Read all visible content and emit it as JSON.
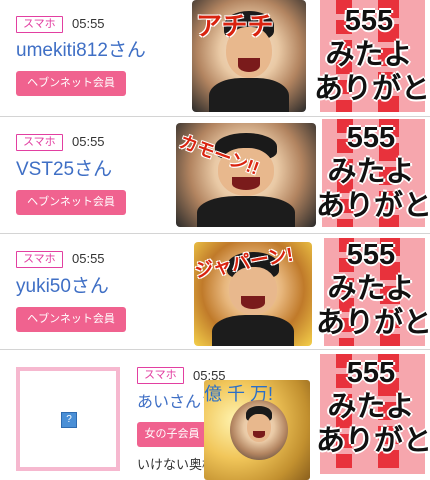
{
  "posts": [
    {
      "device": "スマホ",
      "time": "05:55",
      "name": "umekiti812さん",
      "member_type": "ヘブンネット会員",
      "sticker_text": "アチチ",
      "message": "555 みたよ ありがと"
    },
    {
      "device": "スマホ",
      "time": "05:55",
      "name": "VST25さん",
      "member_type": "ヘブンネット会員",
      "sticker_text": "カモーン!!",
      "message": "555 みたよ ありがと"
    },
    {
      "device": "スマホ",
      "time": "05:55",
      "name": "yuki50さん",
      "member_type": "ヘブンネット会員",
      "sticker_text": "ジャパーン!",
      "message": "555 みたよ ありがと"
    },
    {
      "device": "スマホ",
      "time": "05:55",
      "name": "あいさんさん",
      "member_type": "女の子会員",
      "sticker_text": "億 千 万!",
      "message": "555 みたよ ありがと",
      "body": "いけない奥様 ブログ 日記"
    }
  ],
  "thanks_lines": [
    "555",
    "みたよ",
    "ありがと"
  ],
  "avatar_placeholder": "?",
  "colors": {
    "accent_pink": "#e23fa1",
    "button_pink": "#f0628f",
    "name_blue": "#3f6fc5"
  }
}
